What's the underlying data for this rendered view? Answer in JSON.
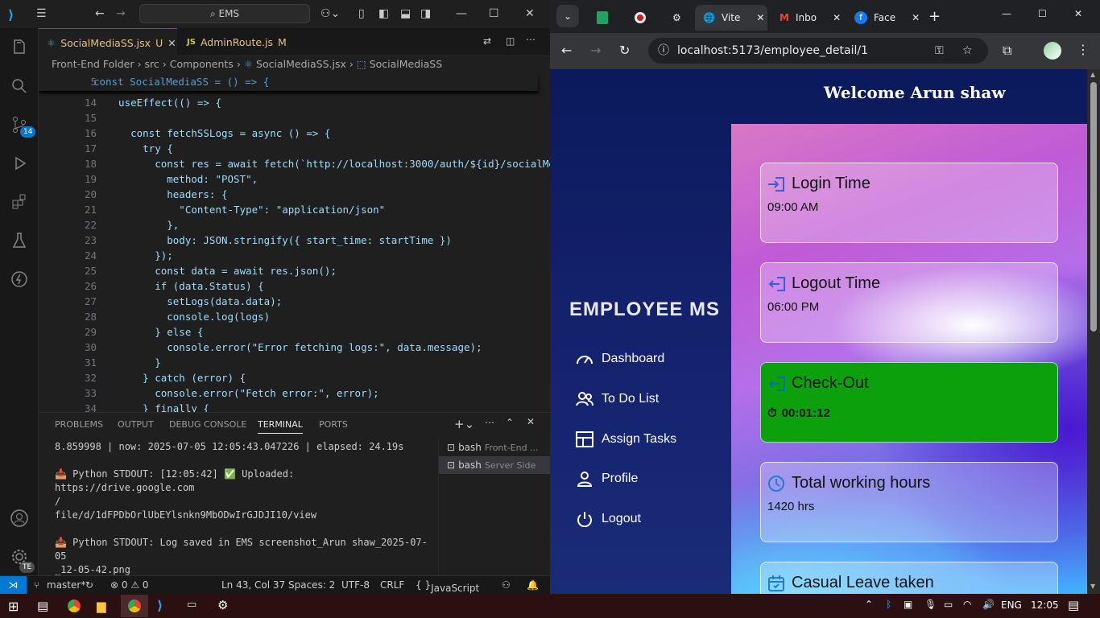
{
  "vscode": {
    "search": "EMS",
    "tabs": [
      {
        "name": "SocialMediaSS.jsx",
        "status": "U"
      },
      {
        "name": "AdminRoute.js",
        "status": "M"
      }
    ],
    "breadcrumb": [
      "Front-End Folder",
      "src",
      "Components",
      "SocialMediaSS.jsx",
      "SocialMediaSS"
    ],
    "sticky_line": {
      "num": "5",
      "code": "const SocialMediaSS = () => {"
    },
    "code_lines": [
      {
        "num": "14",
        "code": "  useEffect(() => {"
      },
      {
        "num": "15",
        "code": ""
      },
      {
        "num": "16",
        "code": "    const fetchSSLogs = async () => {"
      },
      {
        "num": "17",
        "code": "      try {"
      },
      {
        "num": "18",
        "code": "        const res = await fetch(`http://localhost:3000/auth/${id}/socialMe"
      },
      {
        "num": "19",
        "code": "          method: \"POST\","
      },
      {
        "num": "20",
        "code": "          headers: {"
      },
      {
        "num": "21",
        "code": "            \"Content-Type\": \"application/json\""
      },
      {
        "num": "22",
        "code": "          },"
      },
      {
        "num": "23",
        "code": "          body: JSON.stringify({ start_time: startTime })"
      },
      {
        "num": "24",
        "code": "        });"
      },
      {
        "num": "25",
        "code": "        const data = await res.json();"
      },
      {
        "num": "26",
        "code": "        if (data.Status) {"
      },
      {
        "num": "27",
        "code": "          setLogs(data.data);"
      },
      {
        "num": "28",
        "code": "          console.log(logs)"
      },
      {
        "num": "29",
        "code": "        } else {"
      },
      {
        "num": "30",
        "code": "          console.error(\"Error fetching logs:\", data.message);"
      },
      {
        "num": "31",
        "code": "        }"
      },
      {
        "num": "32",
        "code": "      } catch (error) {"
      },
      {
        "num": "33",
        "code": "        console.error(\"Fetch error:\", error);"
      },
      {
        "num": "34",
        "code": "      } finally {"
      }
    ],
    "panel_tabs": [
      "PROBLEMS",
      "OUTPUT",
      "DEBUG CONSOLE",
      "TERMINAL",
      "PORTS"
    ],
    "terminal_lines": [
      "8.859998 | now: 2025-07-05 12:05:43.047226 | elapsed: 24.19s",
      "",
      "📥 Python STDOUT: [12:05:42] ✅ Uploaded: https://drive.google.com",
      "/",
      "file/d/1dFPDbOrlUbEYlsnkn9MbODwIrGJDJI10/view",
      "",
      "📥 Python STDOUT: Log saved in EMS screenshot_Arun shaw_2025-07-05",
      "_12-05-42.png",
      "",
      "▯"
    ],
    "terminals": [
      {
        "name": "bash",
        "desc": "Front-End ..."
      },
      {
        "name": "bash",
        "desc": "Server Side"
      }
    ],
    "status": {
      "branch": "master*",
      "problems": "⊗ 0 ⚠ 0",
      "position": "Ln 43, Col 37",
      "spaces": "Spaces: 2",
      "encoding": "UTF-8",
      "eol": "CRLF",
      "language": "JavaScript JSX"
    },
    "scm_badge": "14",
    "account_badge": "TE"
  },
  "browser": {
    "tabs": [
      "",
      "",
      "",
      "Vite",
      "Inbo",
      "Face"
    ],
    "url": "localhost:5173/employee_detail/1",
    "welcome": "Welcome Arun shaw",
    "brand": "EMPLOYEE MS",
    "nav": [
      "Dashboard",
      "To Do List",
      "Assign Tasks",
      "Profile",
      "Logout"
    ],
    "cards": [
      {
        "title": "Login Time",
        "value": "09:00 AM"
      },
      {
        "title": "Logout Time",
        "value": "06:00 PM"
      },
      {
        "title": "Check-Out",
        "value": "00:01:12"
      },
      {
        "title": "Total working hours",
        "value": "1420 hrs"
      },
      {
        "title": "Casual Leave taken",
        "value": ""
      }
    ]
  },
  "taskbar": {
    "lang": "ENG",
    "time": "12:05"
  }
}
